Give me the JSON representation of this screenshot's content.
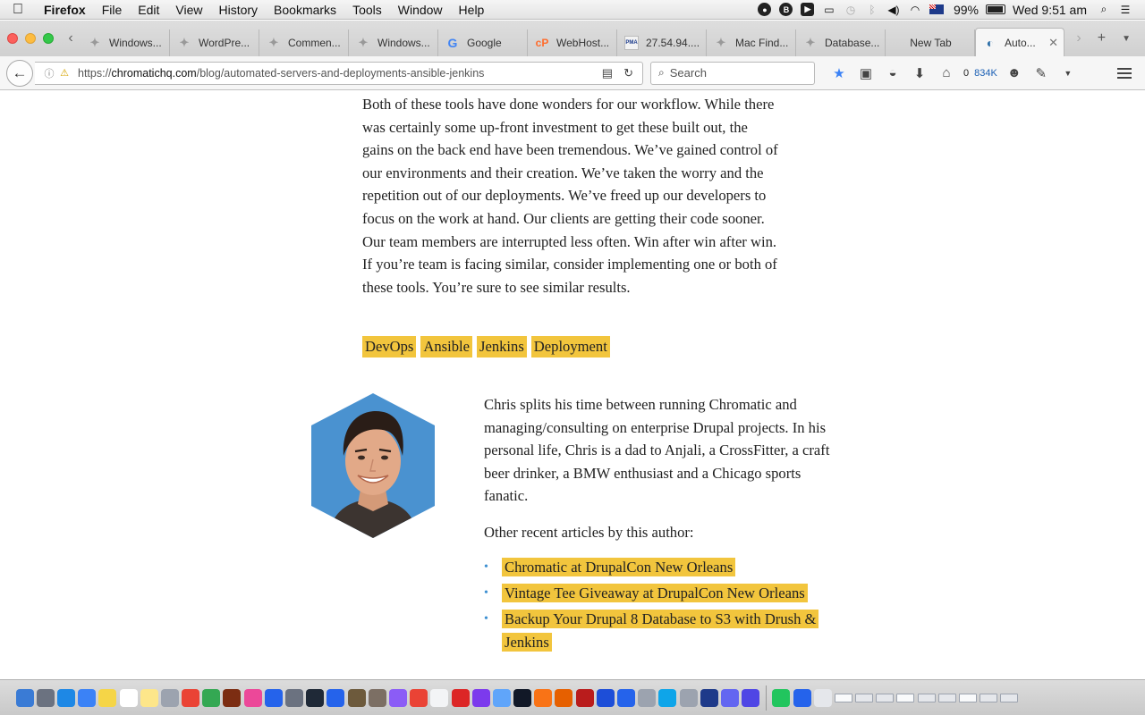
{
  "menubar": {
    "apple_icon": "apple-logo",
    "items": [
      "Firefox",
      "File",
      "Edit",
      "View",
      "History",
      "Bookmarks",
      "Tools",
      "Window",
      "Help"
    ],
    "status_icons": [
      "record-icon",
      "b-icon",
      "media-icon",
      "airplay-icon",
      "time-machine-icon",
      "bluetooth-icon",
      "volume-icon",
      "wifi-icon",
      "flag-au-icon"
    ],
    "battery_percent": "99%",
    "battery_level": 0.99,
    "clock": "Wed 9:51 am"
  },
  "tabs": [
    {
      "label": "Windows...",
      "icon": "generic-favicon"
    },
    {
      "label": "WordPre...",
      "icon": "generic-favicon"
    },
    {
      "label": "Commen...",
      "icon": "generic-favicon"
    },
    {
      "label": "Windows...",
      "icon": "generic-favicon"
    },
    {
      "label": "Google",
      "icon": "google-favicon"
    },
    {
      "label": "WebHost...",
      "icon": "cpanel-favicon"
    },
    {
      "label": "27.54.94....",
      "icon": "phpmyadmin-favicon"
    },
    {
      "label": "Mac Find...",
      "icon": "generic-favicon"
    },
    {
      "label": "Database...",
      "icon": "generic-favicon"
    },
    {
      "label": "New Tab",
      "icon": "none"
    },
    {
      "label": "Auto...",
      "icon": "chromatic-favicon",
      "active": true
    }
  ],
  "tab_favicon_glyphs": {
    "cp": "cP",
    "pma": "PMA",
    "g": "G"
  },
  "navbar": {
    "url_prefix": "https://",
    "url_domain": "chromatichq.com",
    "url_path": "/blog/automated-servers-and-deployments-ansible-jenkins",
    "search_placeholder": "Search",
    "download_count": "0",
    "counter": "834K"
  },
  "article": {
    "paragraph": "Both of these tools have done wonders for our workflow. While there was certainly some up-front investment to get these built out, the gains on the back end have been tremendous. We’ve gained control of our environments and their creation. We’ve taken the worry and the repetition out of our deployments. We’ve freed up our developers to focus on the work at hand. Our clients are getting their code sooner. Our team members are interrupted less often. Win after win after win. If you’re team is facing similar, consider implementing one or both of these tools. You’re sure to see similar results.",
    "tags": [
      "DevOps",
      "Ansible",
      "Jenkins",
      "Deployment"
    ]
  },
  "author": {
    "bio": "Chris splits his time between running Chromatic and managing/consulting on enterprise Drupal projects. In his personal life, Chris is a dad to Anjali, a CrossFitter, a craft beer drinker, a BMW enthusiast and a Chicago sports fanatic.",
    "other_heading": "Other recent articles by this author:",
    "articles": [
      "Chromatic at DrupalCon New Orleans",
      "Vintage Tee Giveaway at DrupalCon New Orleans",
      "Backup Your Drupal 8 Database to S3 with Drush & Jenkins"
    ]
  },
  "colors": {
    "highlight": "#f2c53d",
    "bullet": "#3c8fd1",
    "avatar_bg": "#4a92d0"
  },
  "dock": {
    "icons": [
      "finder-icon",
      "launchpad-icon",
      "safari-icon",
      "mail-icon",
      "notes-icon",
      "calendar-icon",
      "stickies-icon",
      "photos-icon",
      "chrome-icon",
      "messages-icon",
      "photo-booth-icon",
      "itunes-icon",
      "app-store-icon",
      "system-preferences-icon",
      "quicktime-icon",
      "xcode-icon",
      "netbeans-icon",
      "gimp-icon",
      "preview-icon",
      "chrome-icon",
      "textedit-icon",
      "opera-icon",
      "imovie-icon",
      "mail-icon",
      "terminal-icon",
      "vlc-icon",
      "firefox-icon",
      "filezilla-icon",
      "camino-icon",
      "keynote-icon",
      "help-icon",
      "virtualbox-icon",
      "textwrangler-icon",
      "bbedit-icon",
      "sequel-pro-icon",
      "php-icon",
      "android-studio-icon",
      "xcode-icon",
      "trash-icon"
    ]
  }
}
